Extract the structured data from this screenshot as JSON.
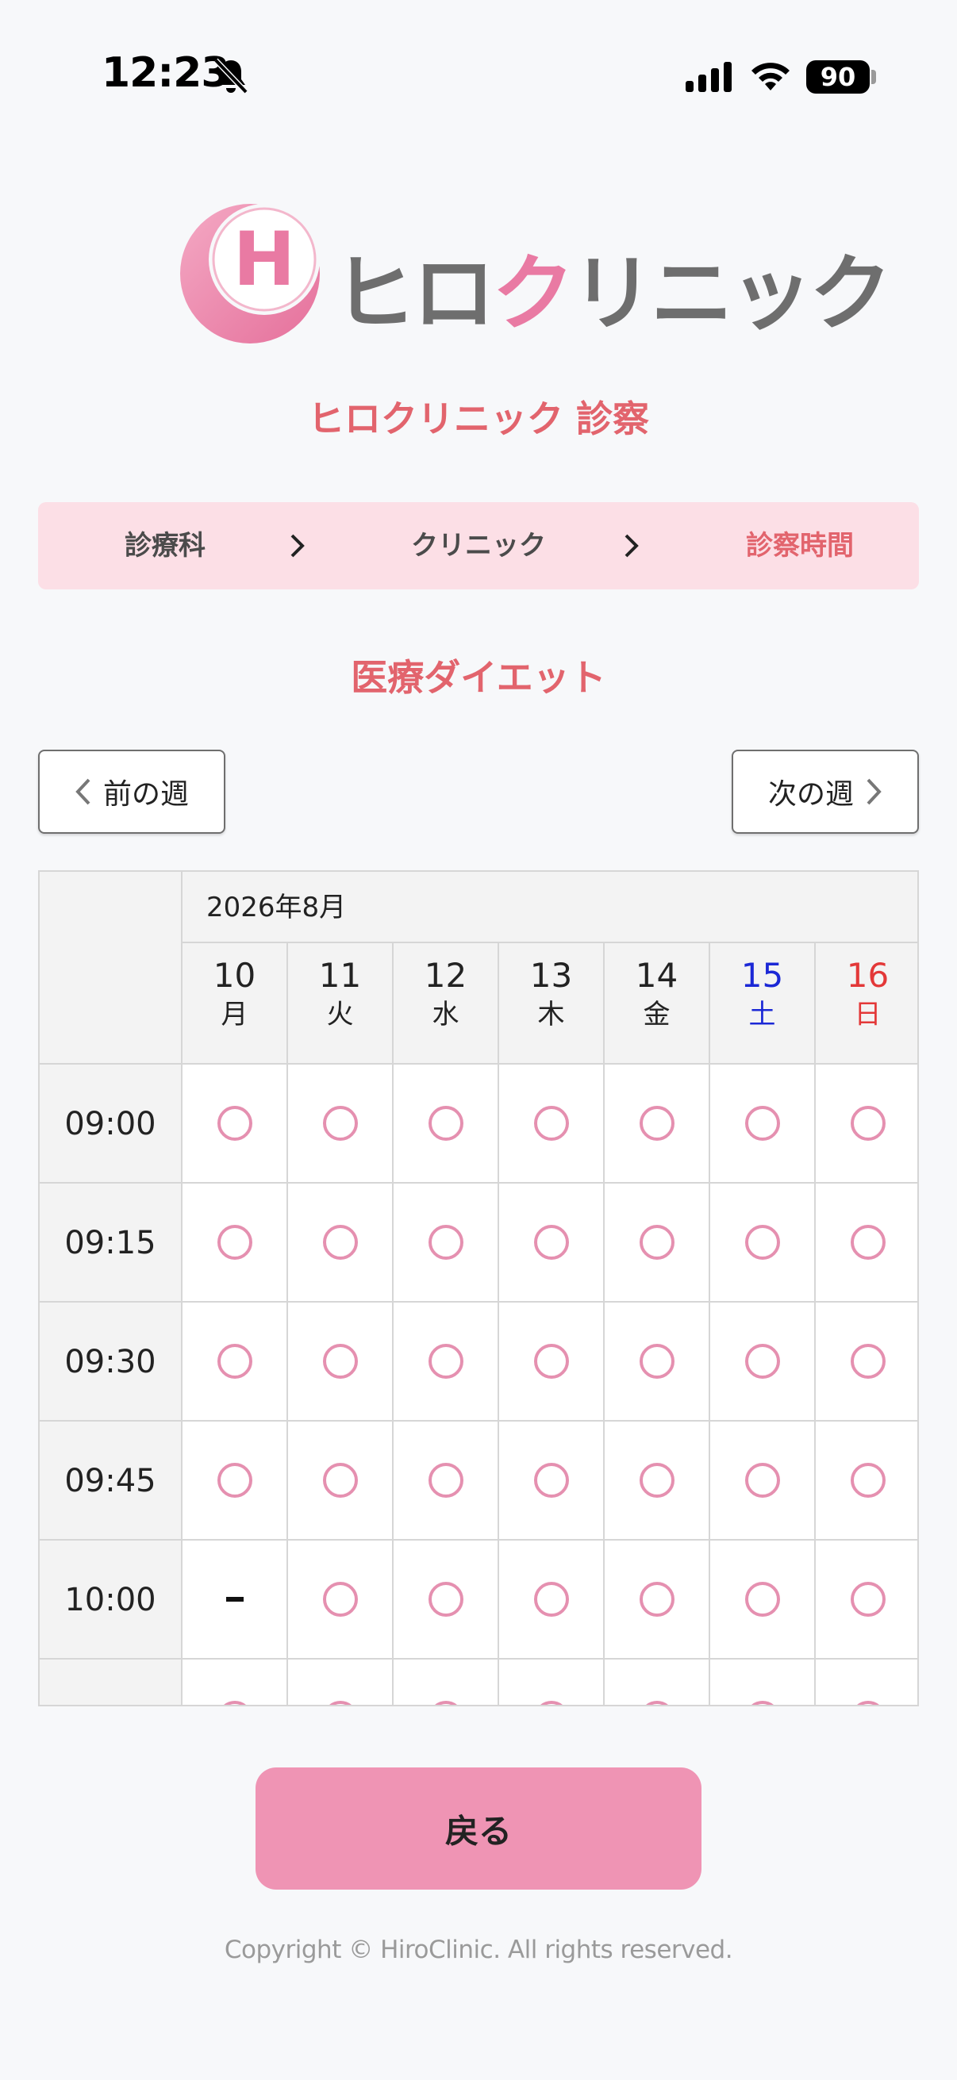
{
  "status_bar": {
    "time": "12:23",
    "battery": "90"
  },
  "logo": {
    "mark_letter": "H",
    "text_part1": "ヒロ",
    "text_part2": "ク",
    "text_part3": "リニック"
  },
  "page_title": "ヒロクリニック 診察",
  "breadcrumb": {
    "step1": "診療科",
    "step2": "クリニック",
    "step3": "診察時間"
  },
  "department_title": "医療ダイエット",
  "week_nav": {
    "prev_label": "前の週",
    "next_label": "次の週"
  },
  "calendar": {
    "month_label": "2026年8月",
    "days": [
      {
        "num": "10",
        "weekday": "月"
      },
      {
        "num": "11",
        "weekday": "火"
      },
      {
        "num": "12",
        "weekday": "水"
      },
      {
        "num": "13",
        "weekday": "木"
      },
      {
        "num": "14",
        "weekday": "金"
      },
      {
        "num": "15",
        "weekday": "土"
      },
      {
        "num": "16",
        "weekday": "日"
      }
    ],
    "rows": [
      {
        "time": "09:00",
        "slots": [
          "available",
          "available",
          "available",
          "available",
          "available",
          "available",
          "available"
        ]
      },
      {
        "time": "09:15",
        "slots": [
          "available",
          "available",
          "available",
          "available",
          "available",
          "available",
          "available"
        ]
      },
      {
        "time": "09:30",
        "slots": [
          "available",
          "available",
          "available",
          "available",
          "available",
          "available",
          "available"
        ]
      },
      {
        "time": "09:45",
        "slots": [
          "available",
          "available",
          "available",
          "available",
          "available",
          "available",
          "available"
        ]
      },
      {
        "time": "10:00",
        "slots": [
          "unavailable",
          "available",
          "available",
          "available",
          "available",
          "available",
          "available"
        ]
      },
      {
        "time": "",
        "slots": [
          "available",
          "available",
          "available",
          "available",
          "available",
          "available",
          "available"
        ]
      }
    ],
    "colors": {
      "available_circle": "#e590b0",
      "saturday": "#1b28d6",
      "sunday": "#e33838"
    }
  },
  "back_button_label": "戻る",
  "copyright": "Copyright © HiroClinic. All rights reserved.",
  "colors": {
    "accent": "#e2646d",
    "breadcrumb_bg": "#fcdfe6",
    "button_pink": "#ef94b4",
    "logo_pink": "#e97aa3"
  }
}
